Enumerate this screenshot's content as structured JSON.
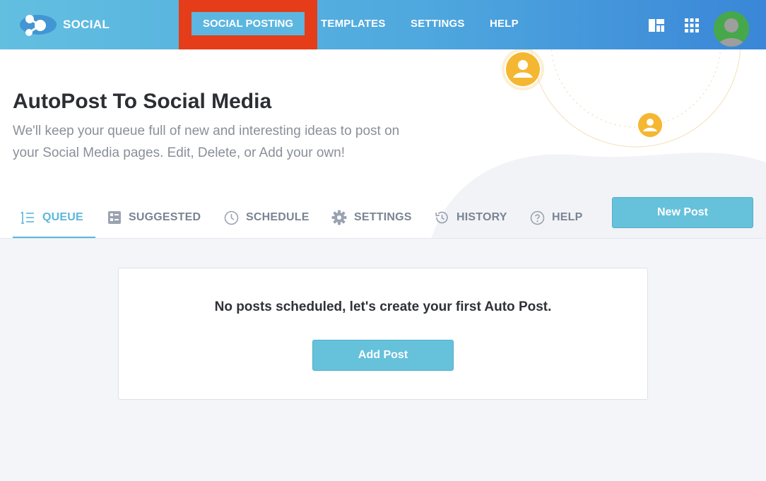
{
  "brand": {
    "name": "SOCIAL"
  },
  "nav": {
    "items": [
      {
        "label": "SOCIAL POSTING",
        "active": true
      },
      {
        "label": "TEMPLATES"
      },
      {
        "label": "SETTINGS"
      },
      {
        "label": "HELP"
      }
    ],
    "icons": [
      "layout-icon",
      "apps-grid-icon",
      "user-avatar"
    ]
  },
  "hero": {
    "title": "AutoPost To Social Media",
    "subtitle_line1": "We'll keep your queue full of new and interesting ideas to post on",
    "subtitle_line2": "your Social Media pages. Edit, Delete, or Add your own!"
  },
  "tabs": [
    {
      "label": "QUEUE",
      "icon": "list-numbered-icon",
      "active": true
    },
    {
      "label": "SUGGESTED",
      "icon": "checklist-icon"
    },
    {
      "label": "SCHEDULE",
      "icon": "clock-icon"
    },
    {
      "label": "SETTINGS",
      "icon": "gear-icon"
    },
    {
      "label": "HISTORY",
      "icon": "history-icon"
    },
    {
      "label": "HELP",
      "icon": "question-icon"
    }
  ],
  "actions": {
    "new_post": "New Post",
    "add_post": "Add Post"
  },
  "empty_state": {
    "message": "No posts scheduled, let's create your first Auto Post."
  },
  "colors": {
    "accent": "#5ab8d9",
    "highlight": "#e53c1a",
    "button": "#66c1db",
    "orange": "#f5b731"
  }
}
